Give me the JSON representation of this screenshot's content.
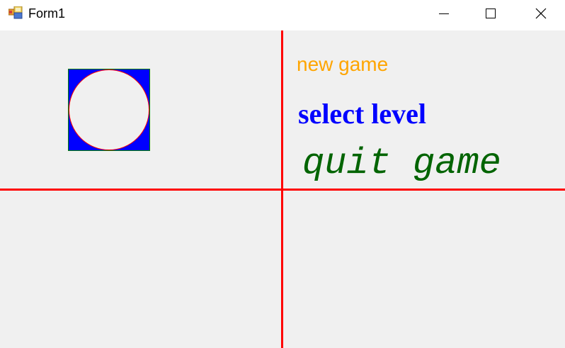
{
  "window": {
    "title": "Form1",
    "icon": "winforms-app-icon",
    "controls": {
      "minimize": "minimize-icon",
      "maximize": "maximize-icon",
      "close": "close-icon"
    }
  },
  "canvas": {
    "grid_color": "#ff0000",
    "shape": {
      "type": "circle-in-square",
      "square_color": "#0000ff",
      "square_border": "#008000",
      "circle_fill": "#f0f0f0",
      "circle_border": "#ff0000"
    }
  },
  "menu": {
    "new_game": {
      "label": "new game",
      "color": "#ffa500"
    },
    "select_level": {
      "label": "select level",
      "color": "#0000ff"
    },
    "quit_game": {
      "label": "quit game",
      "color": "#006400"
    }
  }
}
